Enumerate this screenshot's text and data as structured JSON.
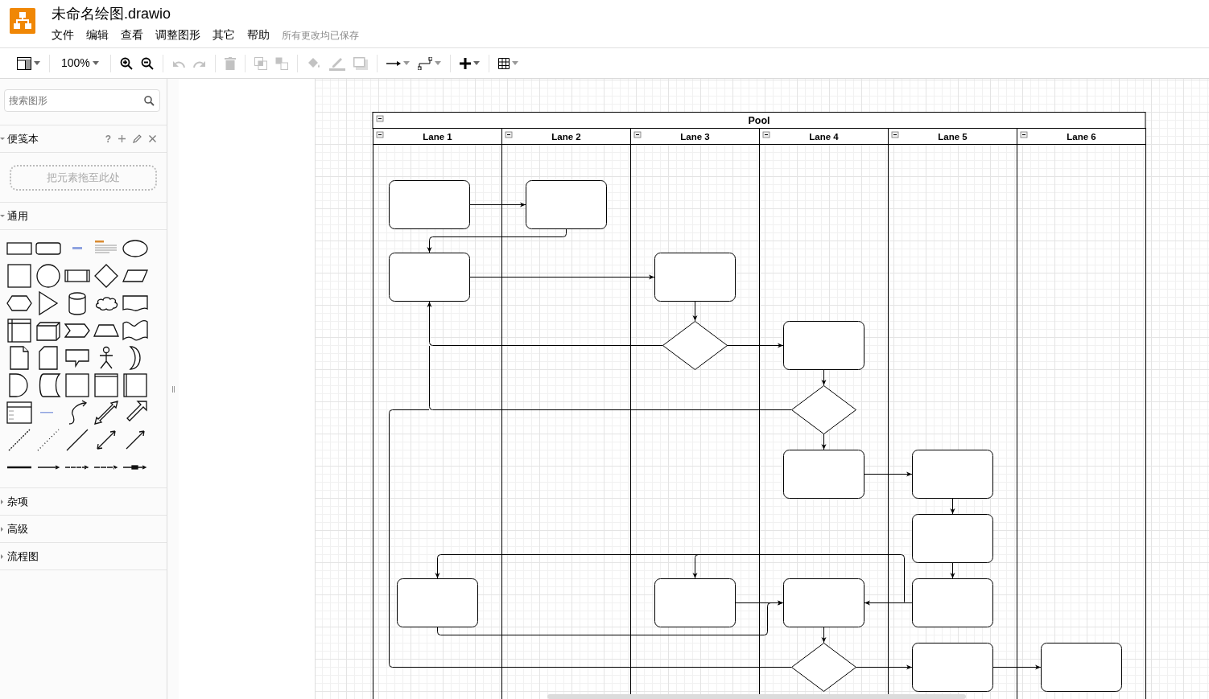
{
  "app": {
    "title": "未命名绘图.drawio",
    "menus": [
      "文件",
      "编辑",
      "查看",
      "调整图形",
      "其它",
      "帮助"
    ],
    "save_status": "所有更改均已保存"
  },
  "toolbar_groups": [
    {
      "items": [
        {
          "kind": "format-panel",
          "disabled": false
        }
      ]
    },
    {
      "items": [
        {
          "kind": "zoom-select",
          "label": "100%",
          "disabled": false
        }
      ]
    },
    {
      "items": [
        {
          "kind": "zoom-in",
          "disabled": false
        },
        {
          "kind": "zoom-out",
          "disabled": false
        }
      ]
    },
    {
      "items": [
        {
          "kind": "undo",
          "disabled": true
        },
        {
          "kind": "redo",
          "disabled": true
        }
      ]
    },
    {
      "items": [
        {
          "kind": "delete",
          "disabled": true
        }
      ]
    },
    {
      "items": [
        {
          "kind": "to-front",
          "disabled": true
        },
        {
          "kind": "to-back",
          "disabled": true
        }
      ]
    },
    {
      "items": [
        {
          "kind": "fill-color",
          "disabled": true
        },
        {
          "kind": "line-color",
          "disabled": true
        },
        {
          "kind": "shadow",
          "disabled": true
        }
      ]
    },
    {
      "items": [
        {
          "kind": "connection",
          "disabled": false
        },
        {
          "kind": "waypoints",
          "disabled": false
        }
      ]
    },
    {
      "items": [
        {
          "kind": "insert",
          "disabled": false
        }
      ]
    },
    {
      "items": [
        {
          "kind": "table",
          "disabled": false
        }
      ]
    }
  ],
  "sidebar": {
    "search": {
      "placeholder": "搜索图形"
    },
    "scratchpad": {
      "title": "便笺本",
      "expanded": true,
      "help": "?",
      "dropzone": "把元素拖至此处"
    },
    "sections": [
      {
        "title": "通用",
        "expanded": true
      },
      {
        "title": "杂项",
        "expanded": false
      },
      {
        "title": "高级",
        "expanded": false
      },
      {
        "title": "流程图",
        "expanded": false
      }
    ]
  },
  "diagram": {
    "pool": {
      "title": "Pool"
    },
    "lanes": [
      {
        "label": "Lane 1"
      },
      {
        "label": "Lane 2"
      },
      {
        "label": "Lane 3"
      },
      {
        "label": "Lane 4"
      },
      {
        "label": "Lane 5"
      },
      {
        "label": "Lane 6"
      }
    ]
  }
}
